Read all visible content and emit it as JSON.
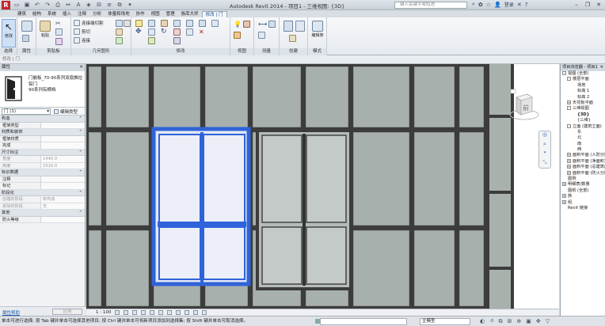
{
  "titlebar": {
    "window_title": "Autodesk Revit 2014 -   项目1 - 三维视图: {3D}",
    "search_placeholder": "键入关键字或短语",
    "user": "登录",
    "help": "?"
  },
  "ribbon_tabs": [
    "建筑",
    "结构",
    "系统",
    "插入",
    "注释",
    "分析",
    "体量和场地",
    "协作",
    "视图",
    "管理",
    "族库大师",
    "修改 | 门"
  ],
  "ribbon_active_tab_index": 11,
  "ribbon": {
    "panels": [
      "选择",
      "属性",
      "剪贴板",
      "几何图形",
      "修改",
      "视图",
      "测量",
      "创建",
      "模式"
    ],
    "modify_label": "修改",
    "paste_label": "粘贴",
    "cut_label": "连接端切割",
    "clip_label": "剪切",
    "join_label": "连接",
    "edit_family_label": "编辑族"
  },
  "properties": {
    "header": "属性",
    "type_name": "门嵌板_70-90系列双扇推拉铝门\n90系列有横档",
    "instance_filter": "门 (1)",
    "edit_type": "编辑类型",
    "groups": [
      {
        "title": "构造",
        "rows": [
          [
            "框架类型",
            ""
          ]
        ]
      },
      {
        "title": "材质和装饰",
        "rows": [
          [
            "框架材质",
            ""
          ],
          [
            "完成",
            ""
          ]
        ]
      },
      {
        "title": "尺寸标注",
        "rows": [
          [
            "宽度",
            "1440.0"
          ],
          [
            "高度",
            "2310.0"
          ]
        ],
        "grey": true
      },
      {
        "title": "标识数据",
        "rows": [
          [
            "注释",
            ""
          ],
          [
            "标记",
            ""
          ]
        ]
      },
      {
        "title": "阶段化",
        "rows": [
          [
            "创建的阶段",
            "新构造"
          ],
          [
            "拆除的阶段",
            "无"
          ]
        ],
        "grey": true
      },
      {
        "title": "其他",
        "rows": [
          [
            "防火等级",
            ""
          ]
        ]
      }
    ],
    "help_link": "属性帮助",
    "apply": "应用"
  },
  "view": {
    "scale": "1 : 100",
    "viewcube_face": "前"
  },
  "browser": {
    "header": "项目浏览器 - 项目1",
    "nodes": [
      {
        "label": "视图 (全部)",
        "indent": 0,
        "toggle": "-"
      },
      {
        "label": "楼层平面",
        "indent": 1,
        "toggle": "-"
      },
      {
        "label": "场地",
        "indent": 2,
        "toggle": ""
      },
      {
        "label": "标高 1",
        "indent": 2,
        "toggle": ""
      },
      {
        "label": "标高 2",
        "indent": 2,
        "toggle": ""
      },
      {
        "label": "天花板平面",
        "indent": 1,
        "toggle": "+"
      },
      {
        "label": "三维视图",
        "indent": 1,
        "toggle": "-"
      },
      {
        "label": "{3D}",
        "indent": 2,
        "toggle": "",
        "bold": true
      },
      {
        "label": "{三维}",
        "indent": 2,
        "toggle": ""
      },
      {
        "label": "立面 (建筑立面)",
        "indent": 1,
        "toggle": "-"
      },
      {
        "label": "东",
        "indent": 2,
        "toggle": ""
      },
      {
        "label": "北",
        "indent": 2,
        "toggle": ""
      },
      {
        "label": "南",
        "indent": 2,
        "toggle": ""
      },
      {
        "label": "西",
        "indent": 2,
        "toggle": ""
      },
      {
        "label": "面积平面 (人防分区面积)",
        "indent": 1,
        "toggle": "+"
      },
      {
        "label": "面积平面 (净面积)",
        "indent": 1,
        "toggle": "+"
      },
      {
        "label": "面积平面 (总建筑面积)",
        "indent": 1,
        "toggle": "+"
      },
      {
        "label": "面积平面 (防火分区面积)",
        "indent": 1,
        "toggle": "+"
      },
      {
        "label": "图例",
        "indent": 0,
        "toggle": ""
      },
      {
        "label": "明细表/数量",
        "indent": 0,
        "toggle": "+"
      },
      {
        "label": "图纸 (全部)",
        "indent": 0,
        "toggle": ""
      },
      {
        "label": "族",
        "indent": 0,
        "toggle": "+"
      },
      {
        "label": "组",
        "indent": 0,
        "toggle": "+"
      },
      {
        "label": "Revit 链接",
        "indent": 0,
        "toggle": ""
      }
    ]
  },
  "status": {
    "text": "单击可进行选择; 按 Tab 键并单击可选择其他项目; 按 Ctrl 键并单击可将新项目添加到选择集; 按 Shift 键并单击可取消选择。",
    "model": "主模型",
    "zero": ":0"
  },
  "colors": {
    "selection_blue": "#2f63d9",
    "panel_fill": "#a7b0ac",
    "mullion": "#3c3c3c",
    "accent": "#2760a8"
  }
}
